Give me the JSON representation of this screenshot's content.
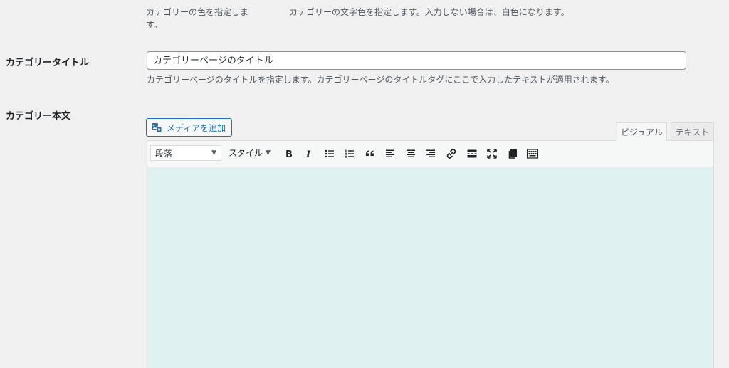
{
  "color_settings": {
    "bg_color_desc": "カテゴリーの色を指定します。",
    "text_color_desc": "カテゴリーの文字色を指定します。入力しない場合は、白色になります。"
  },
  "category_title": {
    "label": "カテゴリータイトル",
    "placeholder": "カテゴリーページのタイトル",
    "description": "カテゴリーページのタイトルを指定します。カテゴリーページのタイトルタグにここで入力したテキストが適用されます。"
  },
  "category_body": {
    "label": "カテゴリー本文",
    "add_media_label": "メディアを追加",
    "tabs": {
      "visual": "ビジュアル",
      "text": "テキスト"
    },
    "toolbar": {
      "format_value": "段落",
      "style_label": "スタイル",
      "buttons": [
        "bold-icon",
        "italic-icon",
        "bullet-list-icon",
        "numbered-list-icon",
        "blockquote-icon",
        "align-left-icon",
        "align-center-icon",
        "align-right-icon",
        "link-icon",
        "read-more-icon",
        "fullscreen-icon",
        "paste-icon",
        "toolbar-toggle-icon"
      ]
    },
    "editor_bg": "#e0f1f1"
  }
}
